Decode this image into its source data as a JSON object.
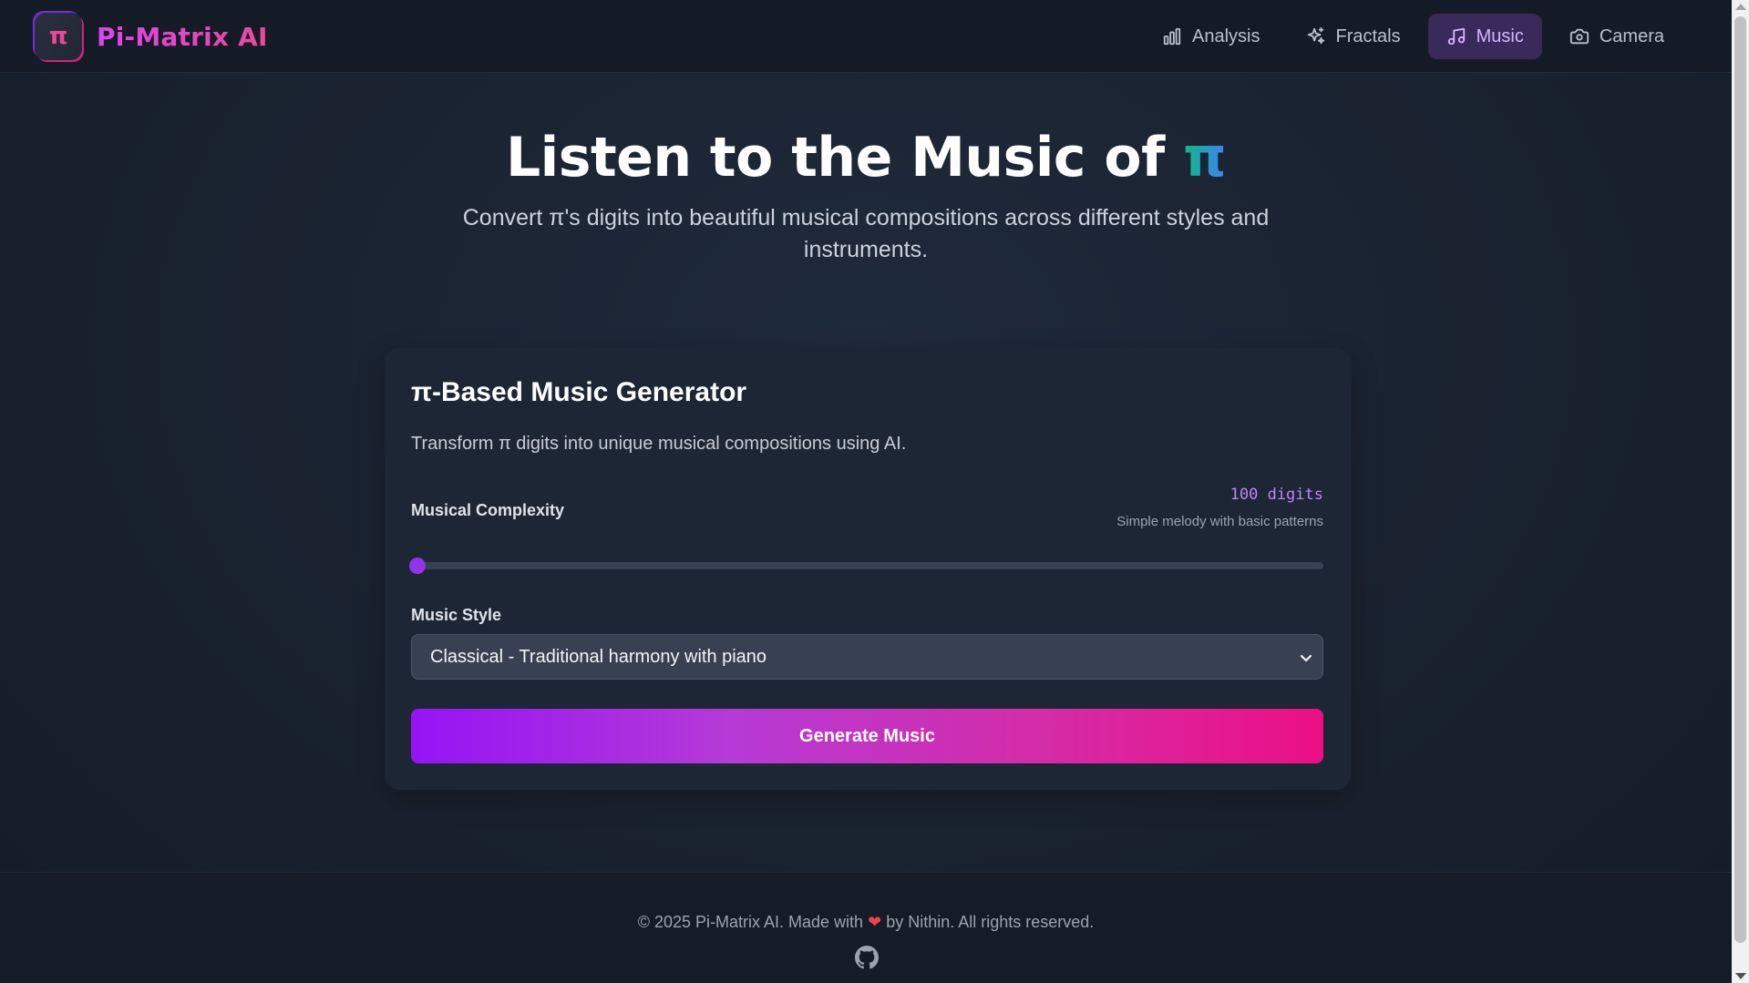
{
  "app": {
    "logo_glyph": "π",
    "name": "Pi-Matrix AI"
  },
  "nav": {
    "items": [
      {
        "label": "Analysis",
        "icon": "bar-chart-icon"
      },
      {
        "label": "Fractals",
        "icon": "sparkles-icon"
      },
      {
        "label": "Music",
        "icon": "music-note-icon",
        "active": true
      },
      {
        "label": "Camera",
        "icon": "camera-icon"
      }
    ]
  },
  "hero": {
    "title": "Listen to the Music of",
    "title_accent": "π",
    "subtitle": "Convert π's digits into beautiful musical compositions across different styles and instruments."
  },
  "generator": {
    "title": "π-Based Music Generator",
    "description": "Transform π digits into unique musical compositions using AI.",
    "complexity_label": "Musical Complexity",
    "digits_value": "100 digits",
    "digits_hint": "Simple melody with basic patterns",
    "slider_fraction": 0.0,
    "style_label": "Music Style",
    "style_selected": "Classical - Traditional harmony with piano",
    "generate_label": "Generate Music"
  },
  "footer": {
    "text_before": "© 2025 Pi-Matrix AI. Made with",
    "heart": "❤",
    "text_after": "by Nithin. All rights reserved.",
    "icon": "github-icon"
  },
  "colors": {
    "accent_purple": "#9333ea",
    "accent_pink": "#ec4899",
    "button_gradient_start": "#9514f5",
    "button_gradient_end": "#ec0f85",
    "pi_gradient_start": "#10b981",
    "pi_gradient_end": "#3b82f6"
  }
}
